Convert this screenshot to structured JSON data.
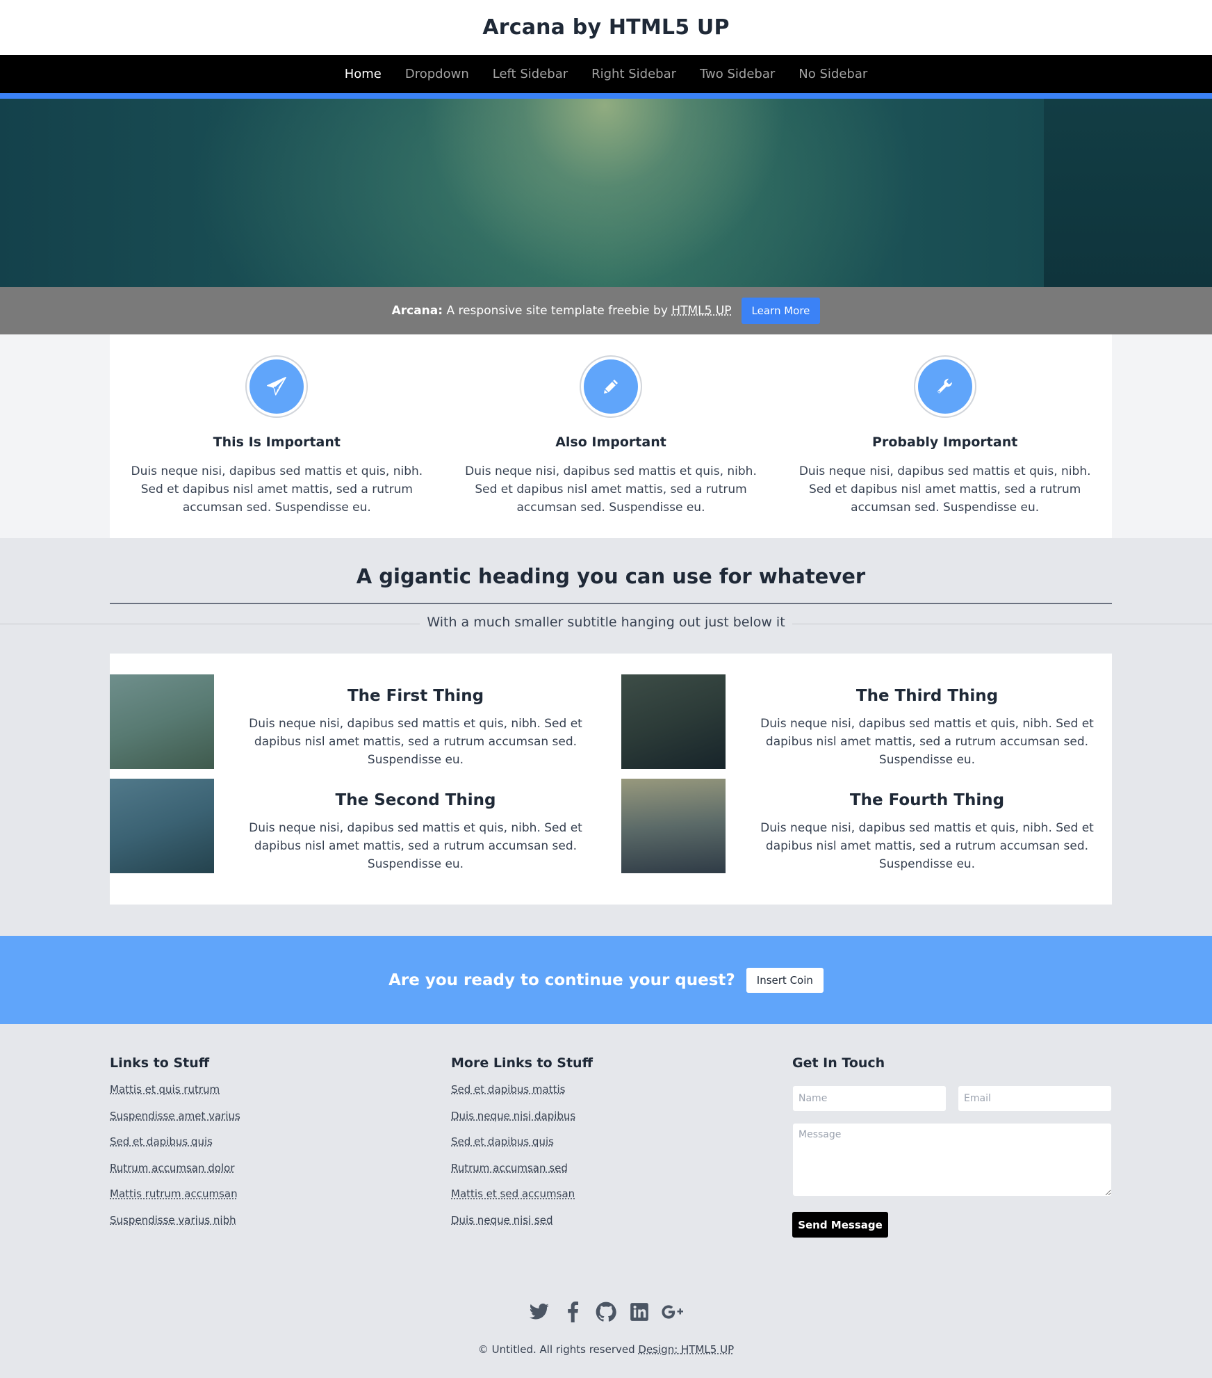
{
  "header": {
    "title": "Arcana by HTML5 UP"
  },
  "nav": {
    "items": [
      {
        "label": "Home"
      },
      {
        "label": "Dropdown"
      },
      {
        "label": "Left Sidebar"
      },
      {
        "label": "Right Sidebar"
      },
      {
        "label": "Two Sidebar"
      },
      {
        "label": "No Sidebar"
      }
    ],
    "active": "Home"
  },
  "intro": {
    "bold": "Arcana:",
    "text": "A responsive site template freebie by",
    "link": "HTML5 UP",
    "button": "Learn More"
  },
  "features": [
    {
      "icon": "paper-plane-icon",
      "title": "This Is Important",
      "text": "Duis neque nisi, dapibus sed mattis et quis, nibh. Sed et dapibus nisl amet mattis, sed a rutrum accumsan sed. Suspendisse eu."
    },
    {
      "icon": "pencil-icon",
      "title": "Also Important",
      "text": "Duis neque nisi, dapibus sed mattis et quis, nibh. Sed et dapibus nisl amet mattis, sed a rutrum accumsan sed. Suspendisse eu."
    },
    {
      "icon": "wrench-icon",
      "title": "Probably Important",
      "text": "Duis neque nisi, dapibus sed mattis et quis, nibh. Sed et dapibus nisl amet mattis, sed a rutrum accumsan sed. Suspendisse eu."
    }
  ],
  "section": {
    "heading": "A gigantic heading you can use for whatever",
    "subtitle": "With a much smaller subtitle hanging out just below it"
  },
  "things": [
    {
      "title": "The First Thing",
      "text": "Duis neque nisi, dapibus sed mattis et quis, nibh. Sed et dapibus nisl amet mattis, sed a rutrum accumsan sed. Suspendisse eu."
    },
    {
      "title": "The Second Thing",
      "text": "Duis neque nisi, dapibus sed mattis et quis, nibh. Sed et dapibus nisl amet mattis, sed a rutrum accumsan sed. Suspendisse eu."
    },
    {
      "title": "The Third Thing",
      "text": "Duis neque nisi, dapibus sed mattis et quis, nibh. Sed et dapibus nisl amet mattis, sed a rutrum accumsan sed. Suspendisse eu."
    },
    {
      "title": "The Fourth Thing",
      "text": "Duis neque nisi, dapibus sed mattis et quis, nibh. Sed et dapibus nisl amet mattis, sed a rutrum accumsan sed. Suspendisse eu."
    }
  ],
  "cta": {
    "text": "Are you ready to continue your quest?",
    "button": "Insert Coin"
  },
  "footer": {
    "col1": {
      "title": "Links to Stuff",
      "links": [
        "Mattis et quis rutrum",
        "Suspendisse amet varius",
        "Sed et dapibus quis",
        "Rutrum accumsan dolor",
        "Mattis rutrum accumsan",
        "Suspendisse varius nibh"
      ]
    },
    "col2": {
      "title": "More Links to Stuff",
      "links": [
        "Sed et dapibus mattis",
        "Duis neque nisi dapibus",
        "Sed et dapibus quis",
        "Rutrum accumsan sed",
        "Mattis et sed accumsan",
        "Duis neque nisi sed"
      ]
    },
    "contact": {
      "title": "Get In Touch",
      "name_placeholder": "Name",
      "email_placeholder": "Email",
      "message_placeholder": "Message",
      "button": "Send Message"
    },
    "social": [
      "twitter-icon",
      "facebook-icon",
      "github-icon",
      "linkedin-icon",
      "google-plus-icon"
    ],
    "copyright": "© Untitled. All rights reserved",
    "design_label": "Design:",
    "design_link": "HTML5 UP"
  },
  "colors": {
    "accent": "#3b82f6",
    "feature_icon": "#60a5fa",
    "cta": "#60a5fa"
  }
}
